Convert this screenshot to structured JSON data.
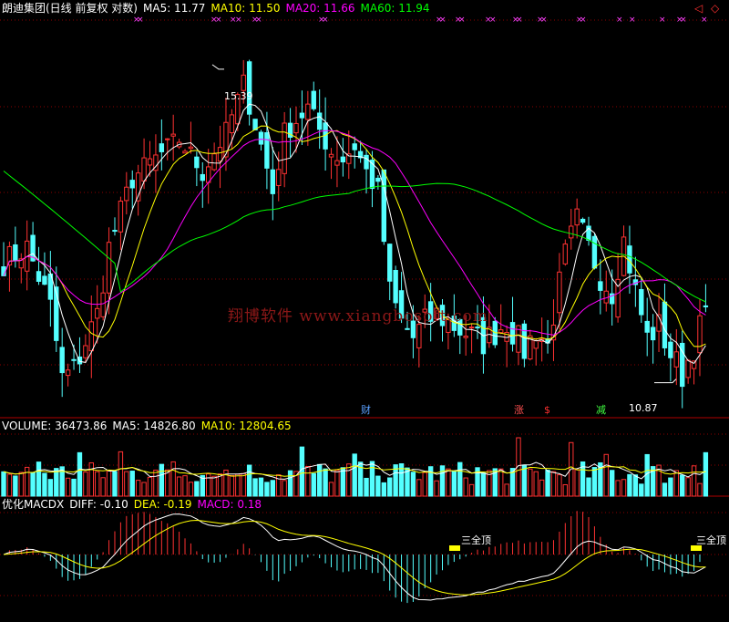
{
  "price_panel": {
    "title": "朗迪集团(日线 前复权 对数)",
    "ma5_label": "MA5: 11.77",
    "ma10_label": "MA10: 11.50",
    "ma20_label": "MA20: 11.66",
    "ma60_label": "MA60: 11.94",
    "high_label": "15.39",
    "low_label": "10.87",
    "event_markers": [
      "财",
      "涨",
      "$",
      "减"
    ],
    "colors": {
      "up": "#ff3232",
      "down": "#54ffff",
      "ma5": "#ffffff",
      "ma10": "#ffff00",
      "ma20": "#ff00ff",
      "ma60": "#00ff00",
      "grid": "#8b0000"
    }
  },
  "volume_panel": {
    "title": "VOLUME: 36473.86",
    "ma5_label": "MA5: 14826.80",
    "ma10_label": "MA10: 12804.65"
  },
  "macd_panel": {
    "title": "优化MACDX",
    "diff_label": "DIFF: -0.10",
    "dea_label": "DEA: -0.19",
    "macd_label": "MACD: 0.18",
    "signal_labels": [
      "三全顶",
      "三全顶"
    ]
  },
  "watermark": "翔博软件 www.xiangbosoft.com",
  "nav": {
    "left_icon": "◁",
    "right_icon": "◇"
  },
  "chart_data": [
    {
      "type": "candlestick",
      "title": "朗迪集团(日线 前复权 对数)",
      "log_scale": true,
      "grid": true,
      "ylim": [
        10.5,
        16.2
      ],
      "annotations": [
        {
          "label": "15.39",
          "value": 15.39
        },
        {
          "label": "10.87",
          "value": 10.87
        }
      ],
      "anchors": [
        [
          0,
          12.4
        ],
        [
          4,
          12.6
        ],
        [
          8,
          11.8
        ],
        [
          10,
          10.9
        ],
        [
          12,
          11.0
        ],
        [
          16,
          11.7
        ],
        [
          18,
          12.6
        ],
        [
          22,
          13.6
        ],
        [
          26,
          13.9
        ],
        [
          30,
          14.2
        ],
        [
          34,
          13.7
        ],
        [
          38,
          14.3
        ],
        [
          41,
          15.1
        ],
        [
          44,
          14.1
        ],
        [
          46,
          13.4
        ],
        [
          48,
          14.3
        ],
        [
          52,
          14.7
        ],
        [
          56,
          14.0
        ],
        [
          58,
          13.9
        ],
        [
          60,
          14.1
        ],
        [
          62,
          13.7
        ],
        [
          64,
          13.4
        ],
        [
          66,
          12.0
        ],
        [
          68,
          11.6
        ],
        [
          70,
          11.4
        ],
        [
          72,
          11.6
        ],
        [
          74,
          11.7
        ],
        [
          78,
          11.5
        ],
        [
          82,
          11.35
        ],
        [
          86,
          11.6
        ],
        [
          89,
          11.25
        ],
        [
          91,
          11.5
        ],
        [
          93,
          11.3
        ],
        [
          96,
          12.5
        ],
        [
          98,
          13.0
        ],
        [
          100,
          12.6
        ],
        [
          102,
          12.2
        ],
        [
          104,
          12.0
        ],
        [
          106,
          12.7
        ],
        [
          108,
          12.0
        ],
        [
          110,
          11.4
        ],
        [
          112,
          11.55
        ],
        [
          114,
          11.2
        ],
        [
          116,
          10.95
        ],
        [
          118,
          11.3
        ],
        [
          120,
          11.75
        ]
      ],
      "series": [
        {
          "name": "MA5",
          "color": "#ffffff",
          "period": 5
        },
        {
          "name": "MA10",
          "color": "#ffff00",
          "period": 10
        },
        {
          "name": "MA20",
          "color": "#ff00ff",
          "period": 20
        },
        {
          "name": "MA60",
          "color": "#00ff00",
          "period": 60
        }
      ]
    },
    {
      "type": "bar",
      "title": "VOLUME: 36473.86",
      "last_value": 36473.86,
      "ma5": 14826.8,
      "ma10": 12804.65
    },
    {
      "type": "bar",
      "title": "优化MACDX",
      "diff": -0.1,
      "dea": -0.19,
      "macd": 0.18
    }
  ]
}
